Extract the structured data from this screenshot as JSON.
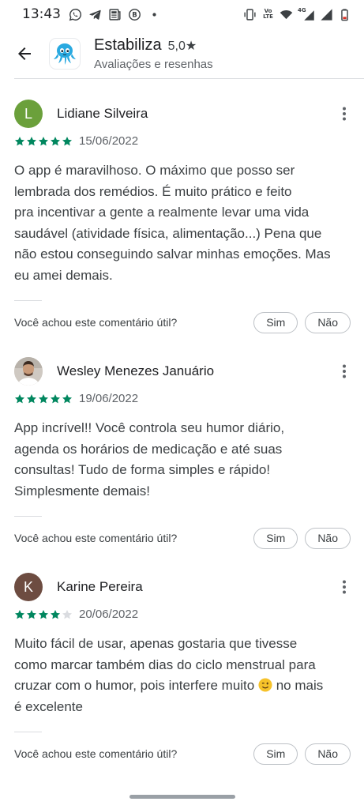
{
  "status_bar": {
    "time": "13:43",
    "left_icons": [
      "whatsapp-icon",
      "telegram-icon",
      "news-icon",
      "b-badge-icon",
      "dot-icon"
    ],
    "right_icons": [
      "vibrate-icon",
      "volte-icon",
      "wifi-icon",
      "signal-4g-icon",
      "signal-icon",
      "battery-icon"
    ],
    "volte_text": "Vo LTE",
    "network_text": "4G"
  },
  "header": {
    "app_name": "Estabiliza",
    "rating": "5,0★",
    "subtitle": "Avaliações e resenhas"
  },
  "colors": {
    "star_filled": "#01875f",
    "star_empty": "#dadce0",
    "avatar_lidiane": "#6ba03b",
    "avatar_karine": "#6d4c41"
  },
  "reviews": [
    {
      "name": "Lidiane Silveira",
      "avatar_letter": "L",
      "stars": 5,
      "date": "15/06/2022",
      "text_lines": [
        "O app é maravilhoso. O máximo que posso ser",
        "lembrada dos remédios. É muito prático e feito",
        "pra incentivar a gente a realmente levar uma vida",
        "saudável (atividade física, alimentação...) Pena que",
        "não estou conseguindo salvar minhas emoções. Mas",
        "eu amei demais."
      ],
      "helpful_question": "Você achou este comentário útil?",
      "yes_label": "Sim",
      "no_label": "Não"
    },
    {
      "name": "Wesley Menezes Januário",
      "avatar_letter": "",
      "stars": 5,
      "date": "19/06/2022",
      "text_lines": [
        "App incrível!! Você controla seu humor diário,",
        "agenda os horários de medicação e até suas",
        "consultas! Tudo de forma simples e rápido!",
        "Simplesmente demais!"
      ],
      "helpful_question": "Você achou este comentário útil?",
      "yes_label": "Sim",
      "no_label": "Não"
    },
    {
      "name": "Karine Pereira",
      "avatar_letter": "K",
      "stars": 4,
      "date": "20/06/2022",
      "text_lines": [
        "Muito fácil de usar, apenas gostaria que tivesse",
        "como marcar também dias do ciclo menstrual para",
        "cruzar com o humor, pois interfere muito",
        "no mais",
        "é excelente"
      ],
      "helpful_question": "Você achou este comentário útil?",
      "yes_label": "Sim",
      "no_label": "Não"
    }
  ]
}
